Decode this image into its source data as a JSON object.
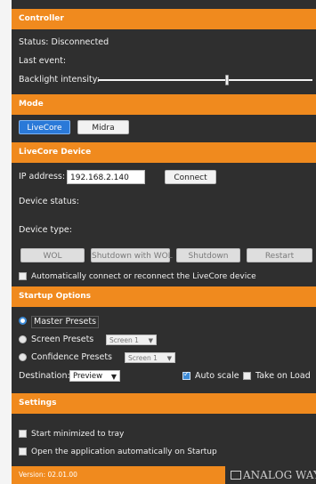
{
  "controller": {
    "header": "Controller",
    "status_label": "Status:",
    "status_value": "Disconnected",
    "last_event_label": "Last event:",
    "backlight_label": "Backlight intensity:",
    "backlight_value": 0.6
  },
  "mode": {
    "header": "Mode",
    "livecore_label": "LiveCore",
    "midra_label": "Midra",
    "selected": "LiveCore"
  },
  "device": {
    "header": "LiveCore Device",
    "ip_label": "IP address:",
    "ip_value": "192.168.2.140",
    "connect_label": "Connect",
    "device_status_label": "Device status:",
    "device_type_label": "Device type:",
    "wol_label": "WOL",
    "shutdown_wol_label": "Shutdown with WOL",
    "shutdown_label": "Shutdown",
    "restart_label": "Restart",
    "auto_connect_label": "Automatically connect or reconnect the LiveCore device",
    "auto_connect_checked": false
  },
  "startup": {
    "header": "Startup Options",
    "master_label": "Master Presets",
    "screen_label": "Screen Presets",
    "screen_select": "Screen 1",
    "confidence_label": "Confidence Presets",
    "confidence_select": "Screen 1",
    "selected": "Master Presets",
    "destination_label": "Destination:",
    "destination_value": "Preview",
    "auto_scale_label": "Auto scale",
    "auto_scale_checked": true,
    "take_on_load_label": "Take on Load",
    "take_on_load_checked": false
  },
  "settings": {
    "header": "Settings",
    "minimized_label": "Start minimized to tray",
    "minimized_checked": false,
    "startup_label": "Open the application automatically on Startup",
    "startup_checked": false
  },
  "footer": {
    "version": "Version: 02.01.00",
    "logo": "ANALOG WAY"
  },
  "colors": {
    "accent": "#f08a1e",
    "panel": "#2f2f2f",
    "selected_button": "#2a79d8"
  }
}
